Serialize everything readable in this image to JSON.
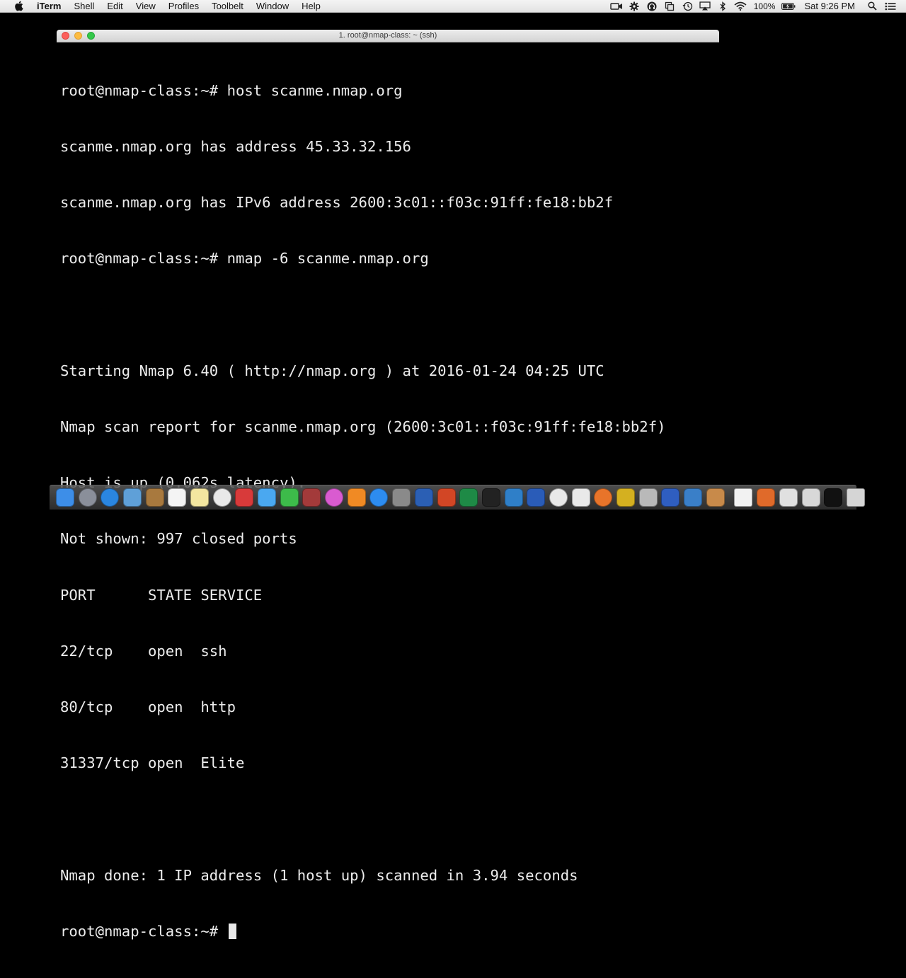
{
  "menubar": {
    "app_name": "iTerm",
    "items": [
      "Shell",
      "Edit",
      "View",
      "Profiles",
      "Toolbelt",
      "Window",
      "Help"
    ],
    "battery": "100%",
    "clock": "Sat 9:26 PM"
  },
  "window": {
    "title": "1. root@nmap-class: ~ (ssh)"
  },
  "terminal": {
    "lines": [
      "root@nmap-class:~# host scanme.nmap.org",
      "scanme.nmap.org has address 45.33.32.156",
      "scanme.nmap.org has IPv6 address 2600:3c01::f03c:91ff:fe18:bb2f",
      "root@nmap-class:~# nmap -6 scanme.nmap.org",
      "",
      "Starting Nmap 6.40 ( http://nmap.org ) at 2016-01-24 04:25 UTC",
      "Nmap scan report for scanme.nmap.org (2600:3c01::f03c:91ff:fe18:bb2f)",
      "Host is up (0.062s latency).",
      "Not shown: 997 closed ports",
      "PORT      STATE SERVICE",
      "22/tcp    open  ssh",
      "80/tcp    open  http",
      "31337/tcp open  Elite",
      "",
      "Nmap done: 1 IP address (1 host up) scanned in 3.94 seconds"
    ],
    "prompt": "root@nmap-class:~# "
  },
  "colors": {
    "terminal_bg": "#000000",
    "terminal_fg": "#ececec",
    "close": "#fc605c",
    "minimize": "#fdbc40",
    "zoom": "#34c84a"
  },
  "dock": {
    "icons": [
      {
        "name": "finder-icon",
        "color": "#3d8ee8"
      },
      {
        "name": "launchpad-icon",
        "color": "#8a8f9a"
      },
      {
        "name": "safari-icon",
        "color": "#2a86e0"
      },
      {
        "name": "preview-icon",
        "color": "#5fa0d8"
      },
      {
        "name": "notebook-icon",
        "color": "#a8793e"
      },
      {
        "name": "calendar-icon",
        "color": "#f4f4f4"
      },
      {
        "name": "notes-icon",
        "color": "#f3e6a0"
      },
      {
        "name": "photos-icon",
        "color": "#e9e9e9"
      },
      {
        "name": "photo-booth-icon",
        "color": "#d83a3a"
      },
      {
        "name": "messages-icon",
        "color": "#4aa8f0"
      },
      {
        "name": "facetime-icon",
        "color": "#3dbb4a"
      },
      {
        "name": "chess-icon",
        "color": "#a33a3a"
      },
      {
        "name": "itunes-icon",
        "color": "#d95bd0"
      },
      {
        "name": "ibooks-icon",
        "color": "#f08a24"
      },
      {
        "name": "app-store-icon",
        "color": "#2d8cf0"
      },
      {
        "name": "system-preferences-icon",
        "color": "#8a8a8a"
      },
      {
        "name": "word-icon",
        "color": "#2b5fb4"
      },
      {
        "name": "powerpoint-icon",
        "color": "#d24625"
      },
      {
        "name": "excel-icon",
        "color": "#1e8a46"
      },
      {
        "name": "terminal-icon",
        "color": "#222222"
      },
      {
        "name": "xcode-icon",
        "color": "#2f7fc8"
      },
      {
        "name": "text-wrangler-icon",
        "color": "#2a5cb8"
      },
      {
        "name": "chrome-icon",
        "color": "#e8e8e8"
      },
      {
        "name": "java-icon",
        "color": "#e9e9e9"
      },
      {
        "name": "firefox-icon",
        "color": "#e8742a"
      },
      {
        "name": "network-icon",
        "color": "#d4b020"
      },
      {
        "name": "keychain-icon",
        "color": "#b9b9b9"
      },
      {
        "name": "virtualbox-icon",
        "color": "#2f5ec0"
      },
      {
        "name": "screenflow-icon",
        "color": "#3a7fc8"
      },
      {
        "name": "archive-icon",
        "color": "#c88a4a"
      },
      {
        "name": "document-icon",
        "color": "#f2f2f2"
      },
      {
        "name": "pdf-icon",
        "color": "#e06a2a"
      },
      {
        "name": "screenshot-icon",
        "color": "#e0e0e0"
      },
      {
        "name": "window-icon",
        "color": "#d8d8d8"
      },
      {
        "name": "terminal-window-icon",
        "color": "#111111"
      },
      {
        "name": "trash-icon",
        "color": "#d5d5d5"
      }
    ]
  }
}
